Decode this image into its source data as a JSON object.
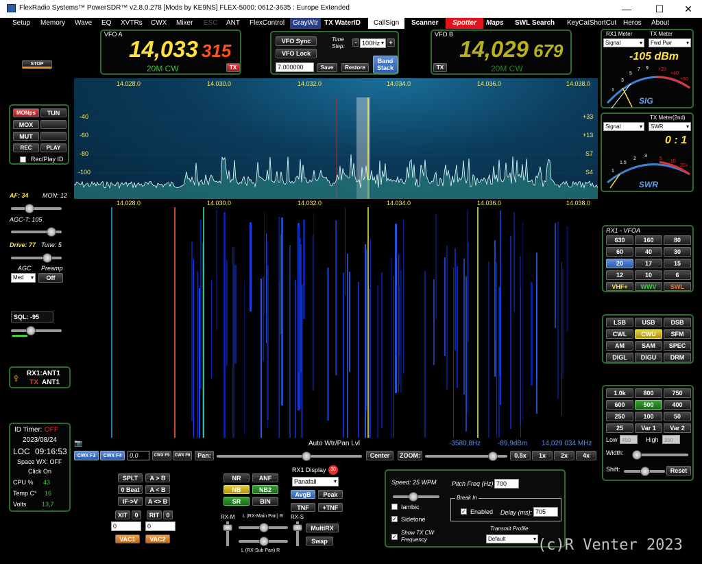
{
  "window": {
    "title": "FlexRadio Systems™  PowerSDR™  v2.8.0.278   [Mods by KE9NS]   FLEX-5000: 0612-3635 : Europe Extended"
  },
  "menu": [
    "Setup",
    "Memory",
    "Wave",
    "EQ",
    "XVTRs",
    "CWX",
    "Mixer",
    "ESC",
    "ANT",
    "FlexControl",
    "GrayWtr",
    "TX WaterID",
    "CallSign",
    "Scanner",
    "Spotter",
    "Maps",
    "SWL Search",
    "KeyCatShortCut",
    "Heros",
    "About"
  ],
  "vfoa": {
    "label": "VFO A",
    "freq_main": "14,033",
    "freq_sub": "315",
    "mode": "20M CW",
    "tx": "TX"
  },
  "vfob": {
    "label": "VFO B",
    "freq_main": "14,029",
    "freq_sub": "679",
    "mode": "20M CW",
    "tx": "TX"
  },
  "center": {
    "vfo_sync": "VFO Sync",
    "vfo_lock": "VFO Lock",
    "tune_step_label": "Tune Step:",
    "tune_step": "100Hz",
    "minus": "-",
    "plus": "+",
    "freq": "7.000000",
    "save": "Save",
    "restore": "Restore",
    "band_stack": "Band Stack"
  },
  "stop": "STOP",
  "tx_controls": {
    "monps": "MONps",
    "tun": "TUN",
    "mox": "MOX",
    "mut": "MUT",
    "rec": "REC",
    "play": "PLAY",
    "recplay_id": "Rec/Play ID"
  },
  "left_sliders": {
    "af": "AF: 34",
    "mon": "MON: 12",
    "agct": "AGC-T: 105",
    "drive": "Drive: 77",
    "tune": "Tune: 5",
    "agc": "AGC",
    "preamp": "Preamp",
    "agc_val": "Med",
    "preamp_val": "Off",
    "sql": "SQL: -95"
  },
  "ant": {
    "rx": "RX1:ANT1",
    "tx_label": "TX",
    "tx": "ANT1"
  },
  "info": {
    "id_timer_label": "ID Timer:",
    "id_timer": "OFF",
    "date": "2023/08/24",
    "loc": "LOC",
    "time": "09:16:53",
    "space_wx": "Space WX: OFF",
    "click_on": "Click On",
    "cpu_label": "CPU %",
    "cpu": "43",
    "temp_label": "Temp C°",
    "temp": "16",
    "volts_label": "Volts",
    "volts": "13,7"
  },
  "panadapter": {
    "top_ticks": [
      "14.028.0",
      "14.030.0",
      "14.032.0",
      "14.034.0",
      "14.036.0",
      "14.038.0"
    ],
    "db_left": [
      "-40",
      "-60",
      "-80",
      "-100"
    ],
    "db_right": [
      "+33",
      "+13",
      "S7",
      "S4"
    ],
    "mid_ticks": [
      "14.028.0",
      "14.030.0",
      "14.032.0",
      "14.034.0",
      "14.036.0",
      "14.038.0"
    ]
  },
  "status_line": {
    "auto_wtr": "Auto Wtr/Pan Lvl",
    "offset": "-3580,8Hz",
    "dbm": "-89,9dBm",
    "freq": "14,029 034 MHz"
  },
  "pan_bar": {
    "cwx_f3": "CWX F3",
    "cwx_f4": "CWX F4",
    "val": "0.0",
    "cwx_f5": "CWX F5",
    "cwx_f6": "CWX F6",
    "pan": "Pan:",
    "center": "Center",
    "zoom": "ZOOM:",
    "z05": "0.5x",
    "z1": "1x",
    "z2": "2x",
    "z4": "4x"
  },
  "split": {
    "splt": "SPLT",
    "atob": "A > B",
    "zerobeat": "0 Beat",
    "btoa": "A < B",
    "ifv": "IF->V",
    "swap": "A <> B",
    "xit": "XIT",
    "xit_n": "0",
    "rit": "RIT",
    "rit_n": "0",
    "xit_val": "0",
    "rit_val": "0",
    "vac1": "VAC1",
    "vac2": "VAC2"
  },
  "dsp": {
    "nr": "NR",
    "anf": "ANF",
    "nb": "NB",
    "nb2": "NB2",
    "sr": "SR",
    "bin": "BIN",
    "rxm": "RX-M",
    "lmain": "L (RX-Main Pan) R",
    "rxs": "RX-S",
    "lsub": "L (RX-Sub Pan) R"
  },
  "rx1display": {
    "label": "RX1 Display",
    "badge": "30",
    "mode": "Panafall",
    "avgb": "AvgB",
    "peak": "Peak",
    "tnf": "TNF",
    "ptnf": "+TNF",
    "multirx": "MultiRX",
    "swap": "Swap"
  },
  "cw": {
    "speed": "Speed: 25 WPM",
    "pitch_label": "Pitch Freq (Hz)",
    "pitch": "700",
    "iambic": "Iambic",
    "sidetone": "Sidetone",
    "show_tx": "Show TX CW Frequency",
    "breakin": "Break In",
    "enabled": "Enabled",
    "delay_label": "Delay (ms):",
    "delay": "705",
    "tx_profile_label": "Transmit Profile",
    "tx_profile": "Default"
  },
  "copyright": "(c)R Venter 2023",
  "meter1": {
    "rx_label": "RX1 Meter",
    "tx_label": "TX Meter",
    "rx_sel": "Signal",
    "tx_sel": "Fwd Pwr",
    "reading": "-105 dBm",
    "scale": [
      "1",
      "3",
      "5",
      "7",
      "9",
      "+20",
      "+40",
      "+60"
    ],
    "name": "SIG"
  },
  "meter2": {
    "label": "TX Meter(2nd)",
    "rx_sel": "Signal",
    "tx_sel": "SWR",
    "reading": "0 : 1",
    "scale": [
      "1",
      "1.5",
      "2",
      "3",
      "5",
      "10",
      "20+"
    ],
    "name": "SWR"
  },
  "bands": {
    "title": "RX1 - VFOA",
    "items": [
      "630",
      "160",
      "80",
      "60",
      "40",
      "30",
      "20",
      "17",
      "15",
      "12",
      "10",
      "6"
    ],
    "vhf": "VHF+",
    "wwv": "WWV",
    "swl": "SWL"
  },
  "modes": [
    "LSB",
    "USB",
    "DSB",
    "CWL",
    "CWU",
    "SFM",
    "AM",
    "SAM",
    "SPEC",
    "DIGL",
    "DIGU",
    "DRM"
  ],
  "filters": {
    "items": [
      "1.0k",
      "800",
      "750",
      "600",
      "500",
      "400",
      "250",
      "100",
      "50",
      "25",
      "Var 1",
      "Var 2"
    ],
    "low_label": "Low",
    "low": "450",
    "high_label": "High",
    "high": "950",
    "width": "Width:",
    "shift": "Shift:",
    "reset": "Reset"
  },
  "colors": {
    "accent_green": "#2d6b2d",
    "vfoa_freq": "#ffe040",
    "vfoa_sub": "#ff5020",
    "vfob_freq": "#b8b020",
    "mode_green": "#39c639",
    "panadapter": "#0a3a5a",
    "spotter": "#e0141e"
  }
}
